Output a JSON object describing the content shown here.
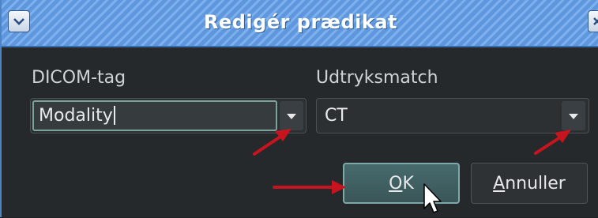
{
  "window": {
    "title": "Redigér prædikat",
    "menu_button_icon": "chevron-down-icon",
    "close_button_icon": "close-icon"
  },
  "form": {
    "dicom_tag": {
      "label": "DICOM-tag",
      "value": "Modality"
    },
    "expression_match": {
      "label": "Udtryksmatch",
      "value": "CT"
    }
  },
  "buttons": {
    "ok": {
      "mnemonic": "O",
      "rest": "K"
    },
    "cancel": {
      "mnemonic": "A",
      "rest": "nnuller"
    }
  },
  "colors": {
    "title_bar": "#5e97dd",
    "background": "#25292b",
    "focus_ring": "#7ba39e",
    "annotation_arrow": "#c8141e"
  }
}
